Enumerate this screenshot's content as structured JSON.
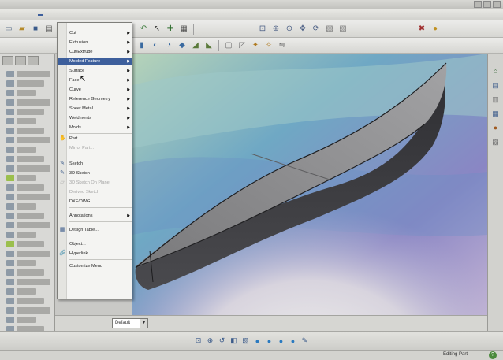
{
  "app": {
    "colors": {
      "menu_highlight": "#3d5f9c",
      "viewport_bg": "#8bb1bf",
      "body_fill": "#8e8e8e",
      "body_dark": "#3a3a3c"
    }
  },
  "menu": {
    "items": [
      {
        "label": "Cut",
        "submenu": true,
        "enabled": true
      },
      {
        "label": "Extrusion",
        "submenu": true,
        "enabled": true
      },
      {
        "label": "Cut/Extrude",
        "submenu": true,
        "enabled": true
      },
      {
        "label": "Molded Feature",
        "submenu": true,
        "enabled": true,
        "highlighted": true
      },
      {
        "label": "Surface",
        "submenu": true,
        "enabled": true
      },
      {
        "label": "Face",
        "submenu": true,
        "enabled": true
      },
      {
        "label": "Curve",
        "submenu": true,
        "enabled": true
      },
      {
        "label": "Reference Geometry",
        "submenu": true,
        "enabled": true
      },
      {
        "label": "Sheet Metal",
        "submenu": true,
        "enabled": true
      },
      {
        "label": "Weldments",
        "submenu": true,
        "enabled": true
      },
      {
        "label": "Molds",
        "submenu": true,
        "enabled": true
      },
      {
        "label": "Part...",
        "icon": "part-icon",
        "enabled": true
      },
      {
        "label": "Mirror Part...",
        "enabled": false
      },
      {
        "label": "Sketch",
        "icon": "sketch-icon",
        "enabled": true
      },
      {
        "label": "3D Sketch",
        "icon": "sketch-3d-icon",
        "enabled": true
      },
      {
        "label": "3D Sketch On Plane",
        "icon": "plane-sketch-icon",
        "enabled": false
      },
      {
        "label": "Derived Sketch",
        "enabled": false
      },
      {
        "label": "DXF/DWG...",
        "enabled": true
      },
      {
        "label": "Annotations",
        "submenu": true,
        "enabled": true
      },
      {
        "label": "Design Table...",
        "icon": "table-icon",
        "enabled": true
      },
      {
        "label": "Object...",
        "enabled": true
      },
      {
        "label": "Hyperlink...",
        "icon": "hyperlink-icon",
        "enabled": true
      },
      {
        "label": "Customize Menu",
        "enabled": true
      }
    ]
  },
  "view_combo": {
    "value": "Default"
  },
  "status": {
    "text": "Editing Part",
    "help": "?"
  },
  "icons": {
    "toolbar_1": [
      "new-icon",
      "open-icon",
      "save-icon",
      "print-icon",
      "undo-icon",
      "select-icon",
      "rebuild-icon",
      "options-icon",
      "zoom-fit-icon",
      "zoom-area-icon",
      "zoom-icon",
      "pan-icon",
      "rotate-icon",
      "view-orientation-icon",
      "display-style-icon",
      "close-icon",
      "settings-icon"
    ],
    "toolbar_2": [
      "extrude-icon",
      "revolve-icon",
      "sweep-icon",
      "loft-icon",
      "fillet-icon",
      "chamfer-icon",
      "shell-icon",
      "draft-icon",
      "rib-icon",
      "pattern-icon",
      "mirror-icon"
    ],
    "right_pane": [
      "resources-icon",
      "library-icon",
      "explorer-icon",
      "view-palette-icon",
      "appearance-icon",
      "properties-icon"
    ],
    "heads_up": [
      "zoom-fit-icon",
      "zoom-area-icon",
      "previous-view-icon",
      "section-view-icon",
      "view-orientation-icon",
      "display-style-icon",
      "hide-show-icon",
      "edit-appearance-icon",
      "apply-scene-icon",
      "view-settings-icon"
    ]
  }
}
